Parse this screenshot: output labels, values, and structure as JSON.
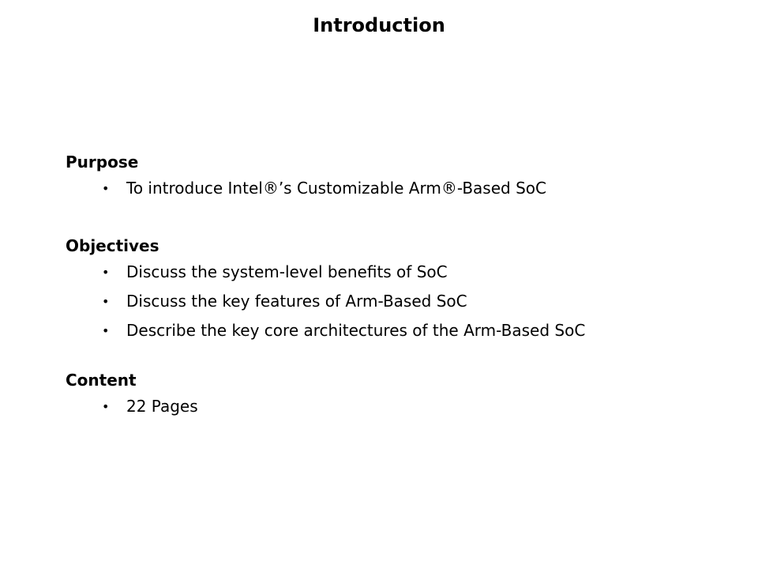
{
  "title": "Introduction",
  "sections": [
    {
      "heading": "Purpose",
      "items": [
        "To introduce Intel®’s Customizable Arm®-Based SoC"
      ]
    },
    {
      "heading": "Objectives",
      "items": [
        "Discuss the system-level benefits of SoC",
        "Discuss the key features of Arm-Based SoC",
        "Describe the key core architectures of the Arm-Based SoC"
      ]
    },
    {
      "heading": "Content",
      "items": [
        "22 Pages"
      ]
    }
  ],
  "bullet_glyph": "•"
}
